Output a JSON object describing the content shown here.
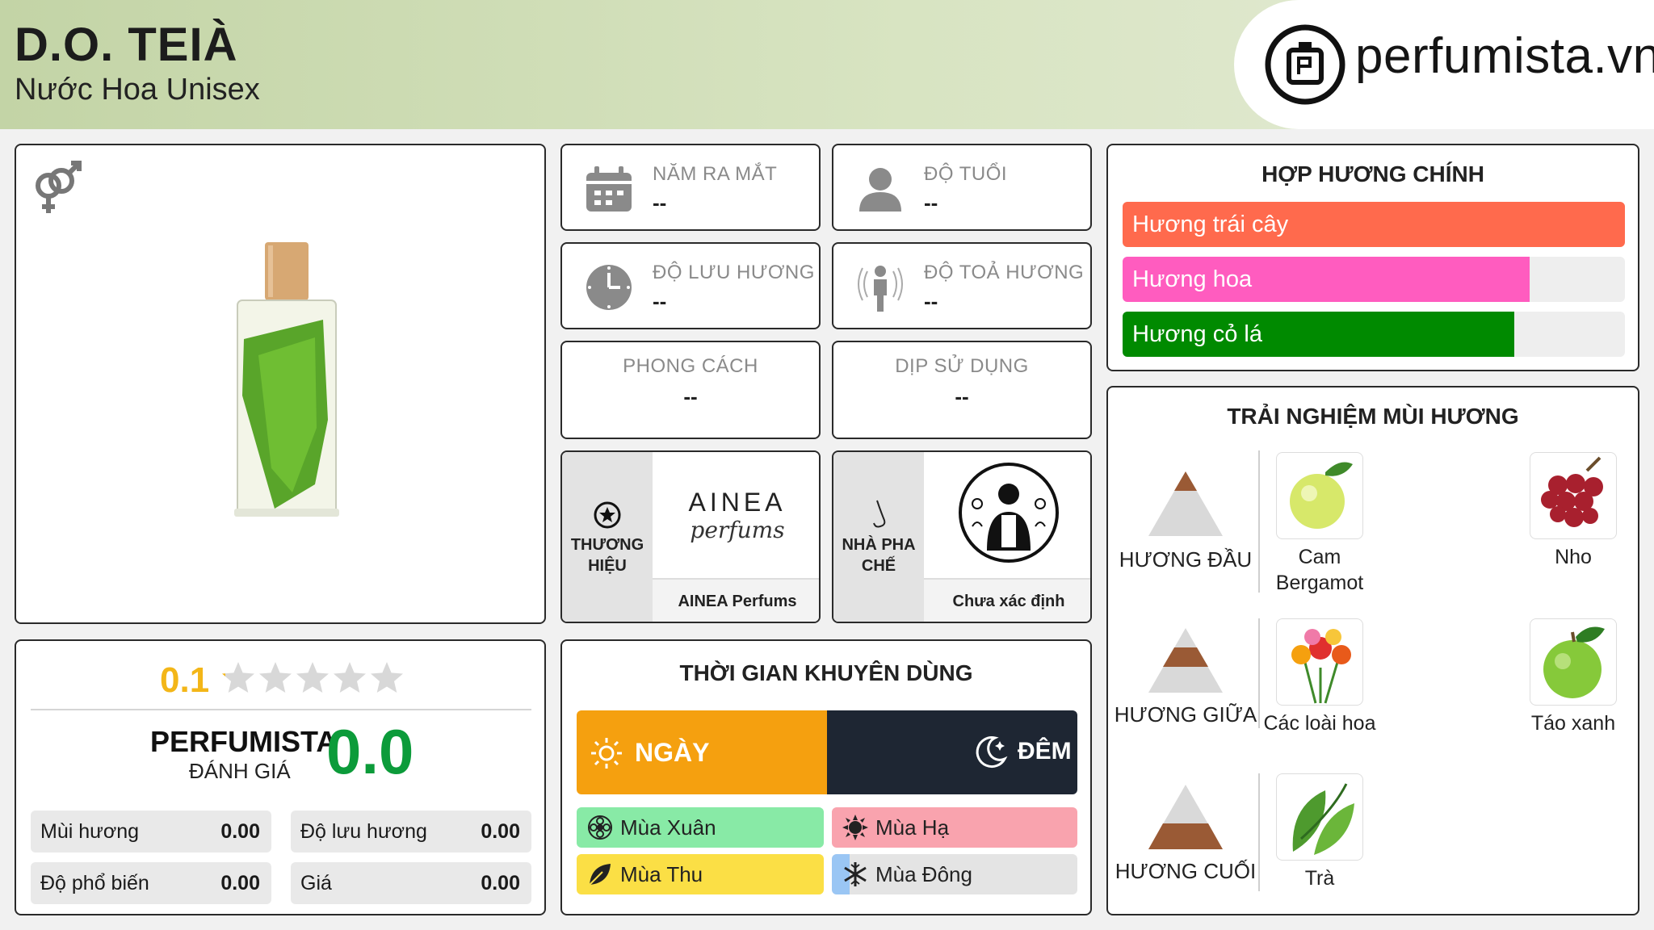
{
  "header": {
    "title": "D.O. TEIÀ",
    "subtitle": "Nước Hoa Unisex",
    "logo_text": "perfumista.vn"
  },
  "stats": {
    "launch_year": {
      "label": "NĂM RA MẮT",
      "value": "--"
    },
    "age": {
      "label": "ĐỘ TUỔI",
      "value": "--"
    },
    "longevity": {
      "label": "ĐỘ LƯU HƯƠNG",
      "value": "--"
    },
    "sillage": {
      "label": "ĐỘ TOẢ HƯƠNG",
      "value": "--"
    },
    "style": {
      "label": "PHONG CÁCH",
      "value": "--"
    },
    "occasion": {
      "label": "DỊP SỬ DỤNG",
      "value": "--"
    }
  },
  "brand": {
    "label_line1": "THƯƠNG",
    "label_line2": "HIỆU",
    "logo_line1": "AINEA",
    "logo_line2": "perfums",
    "name": "AINEA Perfums"
  },
  "perfumer": {
    "label_line1": "NHÀ PHA",
    "label_line2": "CHẾ",
    "name": "Chưa xác định"
  },
  "main_accords": {
    "title": "HỢP HƯƠNG CHÍNH",
    "items": [
      {
        "label": "Hương trái cây",
        "fill": 1.0,
        "color": "#ff6a4d"
      },
      {
        "label": "Hương hoa",
        "fill": 0.81,
        "color": "#ff5cbf"
      },
      {
        "label": "Hương cỏ lá",
        "fill": 0.78,
        "color": "#008a00"
      }
    ]
  },
  "rating": {
    "user_score": "0.1",
    "stars_filled": 0.02,
    "perfumista_label": "PERFUMISTA",
    "review_label": "ĐÁNH GIÁ",
    "perfumista_score": "0.0",
    "rows": [
      {
        "label": "Mùi hương",
        "value": "0.00"
      },
      {
        "label": "Độ lưu hương",
        "value": "0.00"
      },
      {
        "label": "Độ phổ biến",
        "value": "0.00"
      },
      {
        "label": "Giá",
        "value": "0.00"
      }
    ]
  },
  "time_of_use": {
    "title": "THỜI GIAN KHUYÊN DÙNG",
    "day_label": "NGÀY",
    "night_label": "ĐÊM",
    "day_color": "#f5a00f",
    "night_color": "#1e2633",
    "seasons": [
      {
        "label": "Mùa Xuân",
        "color": "#88eaa6",
        "icon": "flower-icon"
      },
      {
        "label": "Mùa Hạ",
        "color": "#f9a3ae",
        "icon": "sun-icon"
      },
      {
        "label": "Mùa Thu",
        "color": "#fbdf45",
        "icon": "leaf-icon"
      },
      {
        "label": "Mùa Đông",
        "color": "#e4e4e4",
        "icon": "snowflake-icon"
      }
    ]
  },
  "notes": {
    "title": "TRẢI NGHIỆM MÙI HƯƠNG",
    "top": {
      "label": "HƯƠNG ĐẦU",
      "items": [
        {
          "line1": "Cam",
          "line2": "Bergamot",
          "icon": "bergamot-image"
        },
        {
          "line1": "Nho",
          "line2": "",
          "icon": "grape-image"
        }
      ]
    },
    "middle": {
      "label": "HƯƠNG GIỮA",
      "items": [
        {
          "line1": "Các loài hoa",
          "line2": "",
          "icon": "flowers-image"
        },
        {
          "line1": "Táo xanh",
          "line2": "",
          "icon": "green-apple-image"
        }
      ]
    },
    "base": {
      "label": "HƯƠNG CUỐI",
      "items": [
        {
          "line1": "Trà",
          "line2": "",
          "icon": "tea-image"
        }
      ]
    }
  }
}
